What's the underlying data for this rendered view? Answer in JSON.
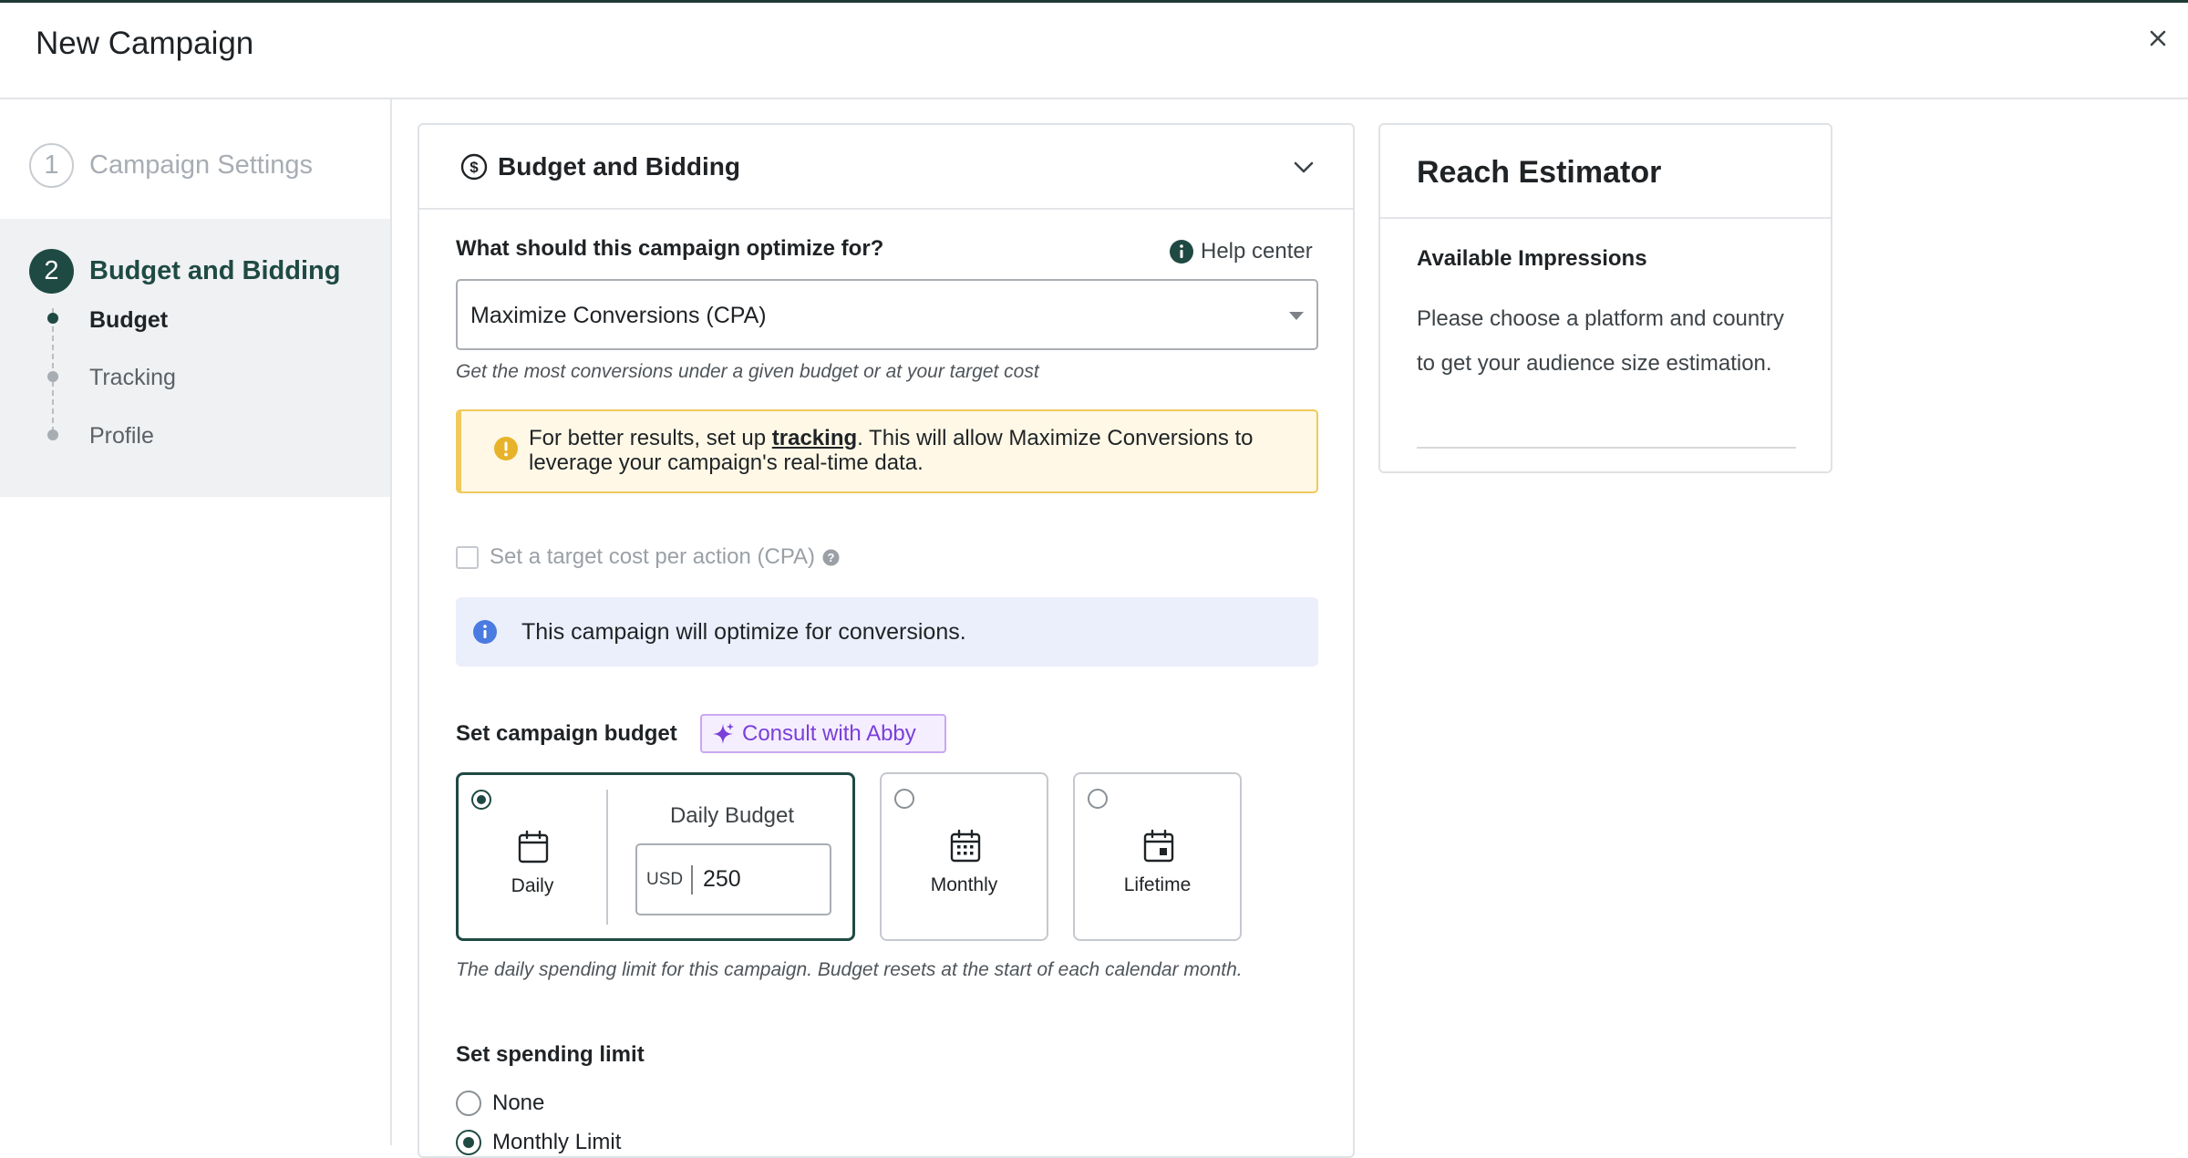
{
  "header": {
    "title": "New Campaign"
  },
  "sidebar": {
    "step1": {
      "number": "1",
      "label": "Campaign Settings"
    },
    "step2": {
      "number": "2",
      "label": "Budget and Bidding"
    },
    "substeps": [
      {
        "label": "Budget"
      },
      {
        "label": "Tracking"
      },
      {
        "label": "Profile"
      }
    ]
  },
  "section": {
    "title": "Budget and Bidding",
    "optimize_question": "What should this campaign optimize for?",
    "help_center": "Help center",
    "optimize_value": "Maximize Conversions (CPA)",
    "optimize_hint": "Get the most conversions under a given budget or at your target cost",
    "warning": {
      "before": "For better results, set up ",
      "link": "tracking",
      "after": ". This will allow Maximize Conversions to leverage your campaign's real-time data."
    },
    "target_cpa_label": "Set a target cost per action (CPA)",
    "info_text": "This campaign will optimize for conversions.",
    "budget_label": "Set campaign budget",
    "abby_button": "Consult with Abby",
    "budget_options": [
      {
        "label": "Daily",
        "selected": true
      },
      {
        "label": "Monthly",
        "selected": false
      },
      {
        "label": "Lifetime",
        "selected": false
      }
    ],
    "daily_budget_label": "Daily Budget",
    "currency": "USD",
    "daily_budget_value": "250",
    "budget_hint": "The daily spending limit for this campaign. Budget resets at the start of each calendar month.",
    "spending_limit_label": "Set spending limit",
    "spending_limit_options": [
      {
        "label": "None",
        "selected": false
      },
      {
        "label": "Monthly Limit",
        "selected": true
      }
    ]
  },
  "reach": {
    "title": "Reach Estimator",
    "subtitle": "Available Impressions",
    "text": "Please choose a platform and country to get your audience size estimation."
  },
  "colors": {
    "primary": "#1f4a43",
    "warning_border": "#f1c95c",
    "warning_bg": "#fff8e6",
    "info_bg": "#ebeffc",
    "info_icon": "#4a7be0",
    "abby_purple": "#7a3fd9"
  },
  "icons": [
    "close-icon",
    "dollar-circle-icon",
    "chevron-down-icon",
    "info-circle-icon",
    "warning-icon",
    "question-icon",
    "sparkle-icon",
    "calendar-icon",
    "calendar-grid-icon",
    "calendar-event-icon"
  ]
}
